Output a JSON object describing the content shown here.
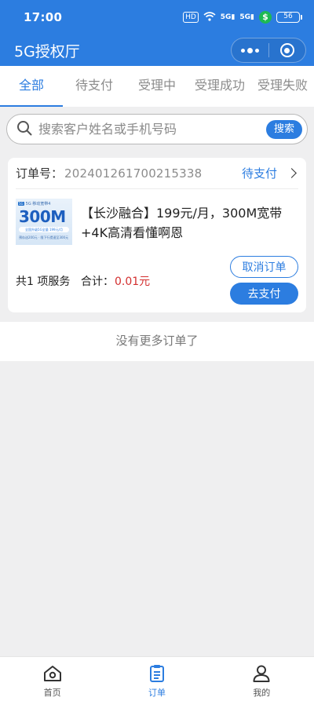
{
  "status_bar": {
    "time": "17:00",
    "hd": "HD",
    "signal1": "5G",
    "signal2": "5G",
    "battery": "56"
  },
  "nav": {
    "title": "5G授权厅"
  },
  "tabs": [
    {
      "label": "全部"
    },
    {
      "label": "待支付"
    },
    {
      "label": "受理中"
    },
    {
      "label": "受理成功"
    },
    {
      "label": "受理失败"
    }
  ],
  "search": {
    "placeholder": "搜索客户姓名或手机号码",
    "button": "搜索"
  },
  "order": {
    "no_label": "订单号：",
    "no": "20240126170021​5338",
    "status": "待支付",
    "product_name": "【长沙融合】199元/月，300M宽带+4K高清看懂啊恩",
    "image": {
      "top": "5G 移动宽带4",
      "big": "300M",
      "bar": "全国升级5G全量 199元/月",
      "foot": "预存送200元 · 限下行提速至300元"
    },
    "service_count": "共1 项服务",
    "total_label": "合计：",
    "total_value": "0.01元",
    "cancel_label": "取消订单",
    "pay_label": "去支付"
  },
  "footer_note": "没有更多订单了",
  "tabbar": [
    {
      "label": "首页",
      "icon": "home-icon"
    },
    {
      "label": "订单",
      "icon": "clipboard-icon"
    },
    {
      "label": "我的",
      "icon": "user-icon"
    }
  ],
  "colors": {
    "primary": "#2c7de0",
    "price": "#d32f2f",
    "background": "#efeff0"
  }
}
